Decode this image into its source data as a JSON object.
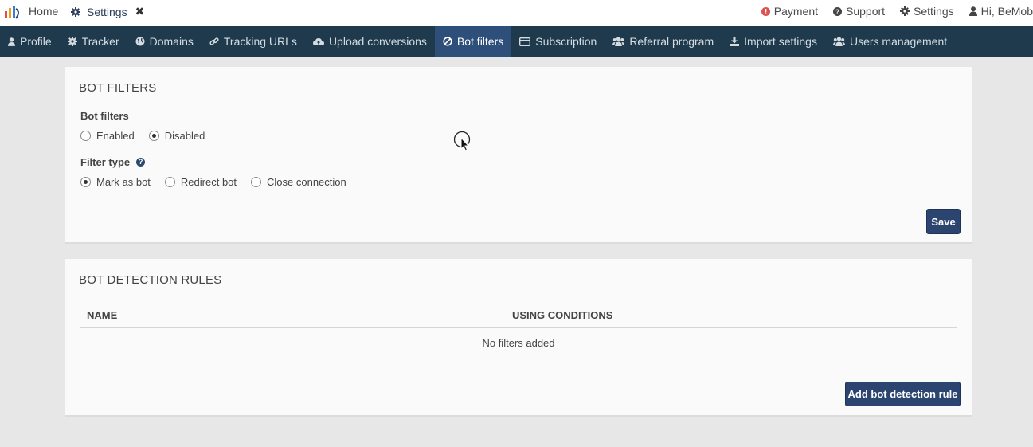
{
  "topbar": {
    "home_label": "Home",
    "tab_label": "Settings",
    "close_glyph": "✖",
    "right": [
      {
        "label": "Payment",
        "icon": "alert-circle-icon",
        "color": "#d9534f"
      },
      {
        "label": "Support",
        "icon": "question-circle-icon"
      },
      {
        "label": "Settings",
        "icon": "gear-icon"
      },
      {
        "label": "Hi, BeMob",
        "icon": "user-icon"
      }
    ]
  },
  "nav": {
    "items": [
      {
        "label": "Profile",
        "icon": "user-icon"
      },
      {
        "label": "Tracker",
        "icon": "gear-icon"
      },
      {
        "label": "Domains",
        "icon": "globe-icon"
      },
      {
        "label": "Tracking URLs",
        "icon": "link-icon"
      },
      {
        "label": "Upload conversions",
        "icon": "cloud-upload-icon"
      },
      {
        "label": "Bot filters",
        "icon": "ban-icon",
        "active": true
      },
      {
        "label": "Subscription",
        "icon": "credit-card-icon"
      },
      {
        "label": "Referral program",
        "icon": "users-icon"
      },
      {
        "label": "Import settings",
        "icon": "download-icon"
      },
      {
        "label": "Users management",
        "icon": "users-icon"
      }
    ]
  },
  "bot_filters": {
    "title": "BOT FILTERS",
    "bot_filters_label": "Bot filters",
    "options": [
      "Enabled",
      "Disabled"
    ],
    "selected": "Disabled",
    "filter_type_label": "Filter type",
    "filter_type_options": [
      "Mark as bot",
      "Redirect bot",
      "Close connection"
    ],
    "filter_type_selected": "Mark as bot",
    "save_label": "Save"
  },
  "rules": {
    "title": "BOT DETECTION RULES",
    "columns": [
      "NAME",
      "USING CONDITIONS"
    ],
    "empty_message": "No filters added",
    "add_label": "Add bot detection rule"
  },
  "colors": {
    "nav_bg": "#1e3a4c",
    "nav_active": "#2d4f7a",
    "button": "#2c4470"
  }
}
